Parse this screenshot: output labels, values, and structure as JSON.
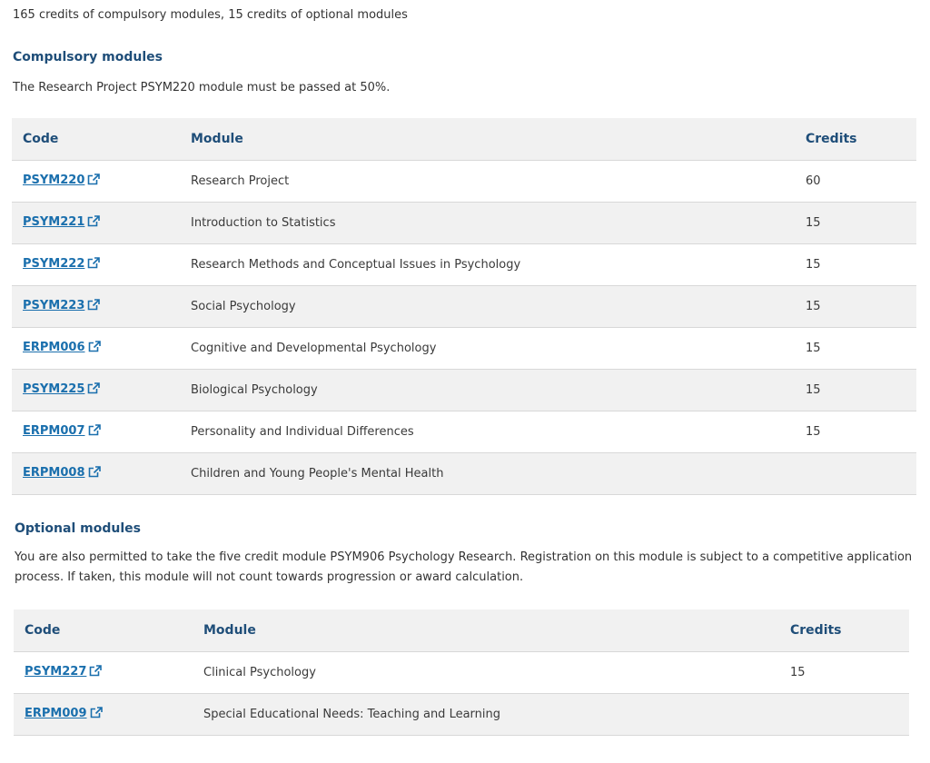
{
  "intro": "165 credits of compulsory modules, 15 credits of optional modules",
  "compulsory": {
    "heading": "Compulsory modules",
    "note": "The Research Project PSYM220 module must be passed at 50%.",
    "columns": {
      "code": "Code",
      "module": "Module",
      "credits": "Credits"
    },
    "rows": [
      {
        "code": "PSYM220",
        "module": "Research Project",
        "credits": "60"
      },
      {
        "code": "PSYM221",
        "module": "Introduction to Statistics",
        "credits": "15"
      },
      {
        "code": "PSYM222",
        "module": "Research Methods and Conceptual Issues in Psychology",
        "credits": "15"
      },
      {
        "code": "PSYM223",
        "module": "Social Psychology",
        "credits": "15"
      },
      {
        "code": "ERPM006",
        "module": "Cognitive and Developmental Psychology",
        "credits": "15"
      },
      {
        "code": "PSYM225",
        "module": "Biological Psychology",
        "credits": "15"
      },
      {
        "code": "ERPM007",
        "module": "Personality and Individual Differences",
        "credits": "15"
      },
      {
        "code": "ERPM008",
        "module": "Children and Young People's Mental Health",
        "credits": ""
      }
    ]
  },
  "optional": {
    "heading": "Optional modules",
    "note": "You are also permitted to take the five credit module PSYM906 Psychology Research. Registration on this module is subject to a competitive application process. If taken, this module will not count towards progression or award calculation.",
    "columns": {
      "code": "Code",
      "module": "Module",
      "credits": "Credits"
    },
    "rows": [
      {
        "code": "PSYM227",
        "module": "Clinical Psychology",
        "credits": "15"
      },
      {
        "code": "ERPM009",
        "module": "Special Educational Needs: Teaching and Learning",
        "credits": ""
      }
    ]
  },
  "icons": {
    "module_link": "external-link-icon"
  },
  "colors": {
    "heading": "#1f4e79",
    "link": "#1a6fad",
    "row_alt": "#f1f1f1"
  }
}
